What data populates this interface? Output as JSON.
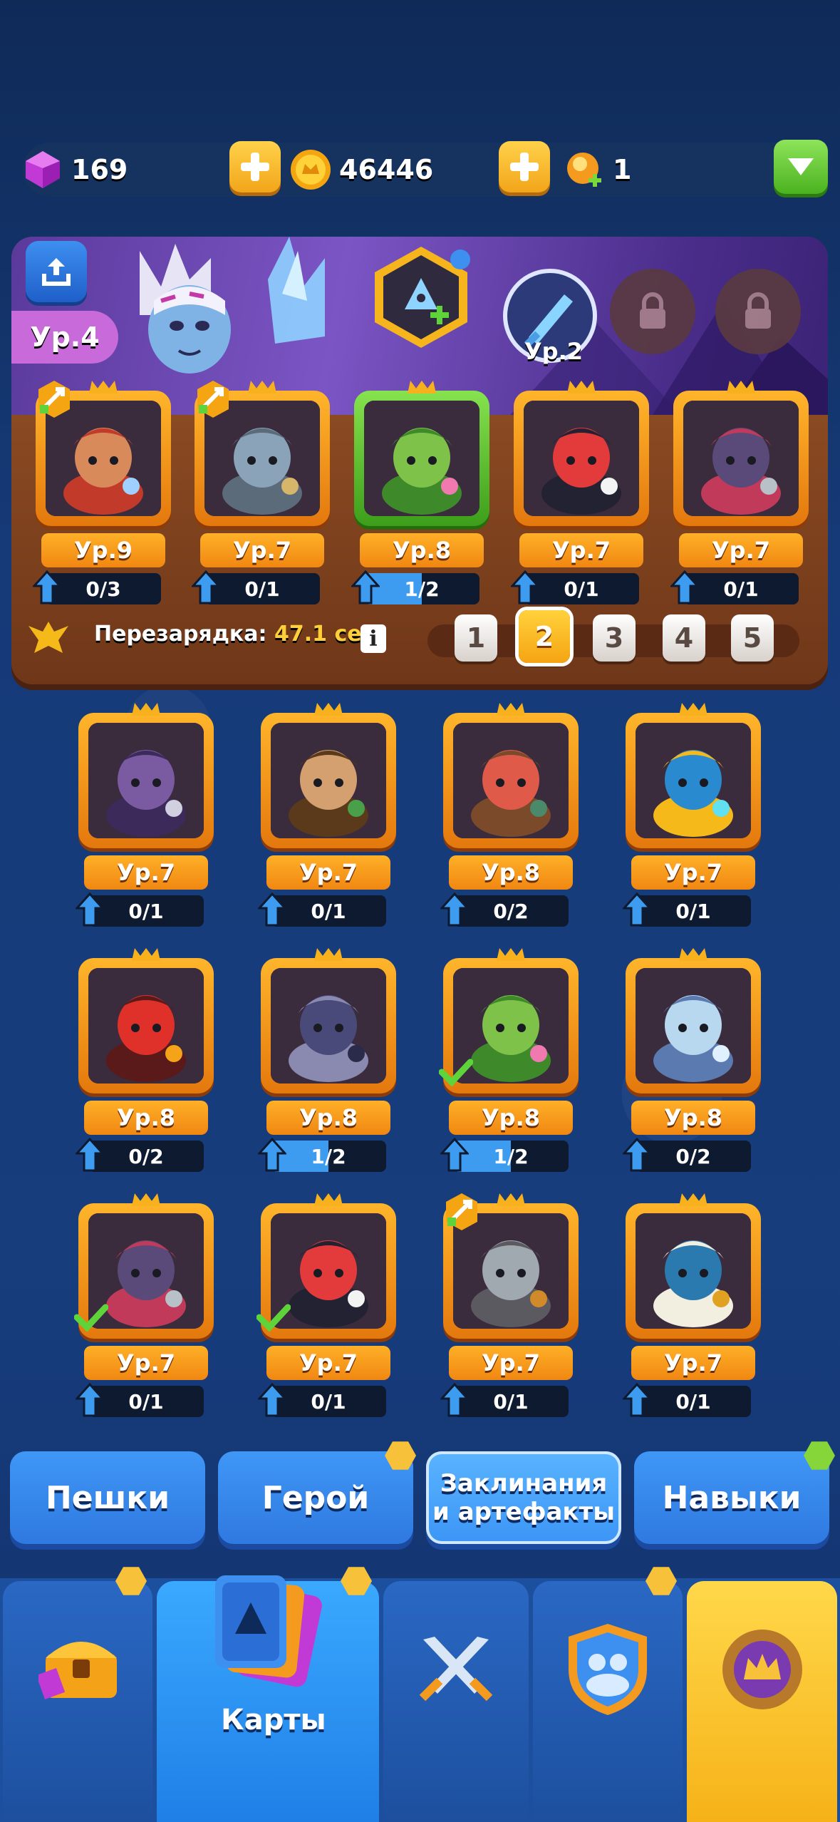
{
  "resources": {
    "gems": "169",
    "coins": "46446",
    "energy": "1"
  },
  "hero_panel": {
    "hero_level": "Ур.4",
    "skill_level": "Ур.2"
  },
  "deck_cards": [
    {
      "level": "Ур.9",
      "progress": "0/3",
      "fill": 0,
      "frame": "gold",
      "upgrade": true,
      "portrait": "monk"
    },
    {
      "level": "Ур.7",
      "progress": "0/1",
      "fill": 0,
      "frame": "gold",
      "upgrade": true,
      "portrait": "engineer"
    },
    {
      "level": "Ур.8",
      "progress": "1/2",
      "fill": 0.5,
      "frame": "green",
      "upgrade": false,
      "portrait": "dryad"
    },
    {
      "level": "Ур.7",
      "progress": "0/1",
      "fill": 0,
      "frame": "gold",
      "upgrade": false,
      "portrait": "harlequin"
    },
    {
      "level": "Ур.7",
      "progress": "0/1",
      "fill": 0,
      "frame": "gold",
      "upgrade": false,
      "portrait": "gunslinger"
    }
  ],
  "recharge": {
    "label": "Перезарядка:",
    "value": "47.1 сек.",
    "info": "i"
  },
  "deck_pages": [
    "1",
    "2",
    "3",
    "4",
    "5"
  ],
  "active_page": "2",
  "collection": [
    {
      "level": "Ур.7",
      "progress": "0/1",
      "fill": 0,
      "portrait": "vampire"
    },
    {
      "level": "Ур.7",
      "progress": "0/1",
      "fill": 0,
      "portrait": "leprechaun"
    },
    {
      "level": "Ур.8",
      "progress": "0/2",
      "fill": 0,
      "portrait": "rogue"
    },
    {
      "level": "Ур.7",
      "progress": "0/1",
      "fill": 0,
      "portrait": "paladin"
    },
    {
      "level": "Ур.8",
      "progress": "0/2",
      "fill": 0,
      "portrait": "fire-mage"
    },
    {
      "level": "Ур.8",
      "progress": "1/2",
      "fill": 0.5,
      "portrait": "assassin"
    },
    {
      "level": "Ур.8",
      "progress": "1/2",
      "fill": 0.5,
      "portrait": "dryad",
      "check": true
    },
    {
      "level": "Ур.8",
      "progress": "0/2",
      "fill": 0,
      "portrait": "frost-knight"
    },
    {
      "level": "Ур.7",
      "progress": "0/1",
      "fill": 0,
      "portrait": "gunslinger",
      "check": true
    },
    {
      "level": "Ур.7",
      "progress": "0/1",
      "fill": 0,
      "portrait": "harlequin",
      "check": true
    },
    {
      "level": "Ур.7",
      "progress": "0/1",
      "fill": 0,
      "portrait": "knight",
      "upgrade": true
    },
    {
      "level": "Ур.7",
      "progress": "0/1",
      "fill": 0,
      "portrait": "genie"
    }
  ],
  "tabs": {
    "pawns": "Пешки",
    "hero": "Герой",
    "spells_line1": "Заклинания",
    "spells_line2": "и артефакты",
    "skills": "Навыки"
  },
  "nav": {
    "cards_label": "Карты"
  },
  "colors": {
    "accent_gold": "#f5a412",
    "tab_blue": "#3f97f6",
    "panel_brown": "#7a3b1f"
  }
}
